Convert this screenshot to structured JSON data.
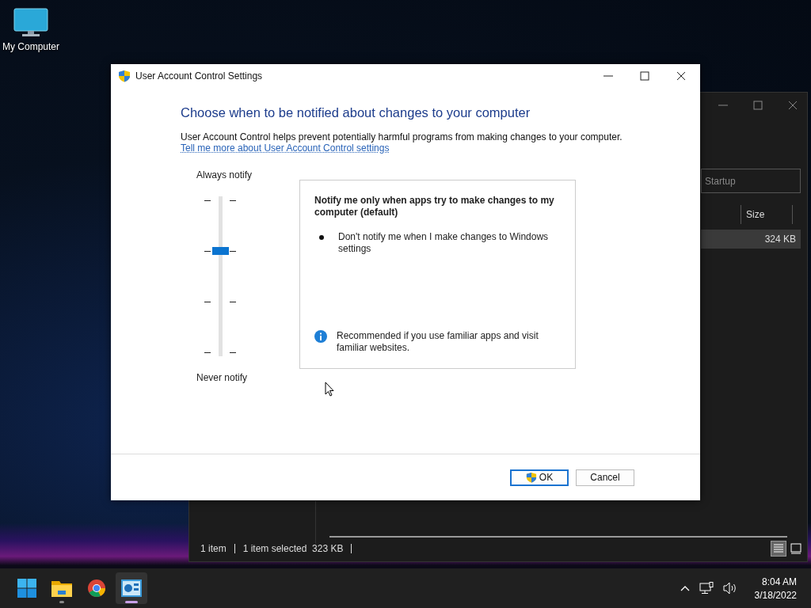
{
  "desktop": {
    "icons": [
      {
        "label": "My Computer"
      }
    ]
  },
  "explorer": {
    "search": {
      "placeholder": "Startup"
    },
    "columns": [
      "Size"
    ],
    "rows": [
      {
        "size": "324 KB",
        "selected": true
      }
    ],
    "status_bar": {
      "items": "1 item",
      "selection": "1 item selected  323 KB"
    },
    "views": [
      {
        "kind": "details",
        "selected": true
      },
      {
        "kind": "tiles",
        "selected": false
      }
    ]
  },
  "dialog": {
    "title": "User Account Control Settings",
    "heading": "Choose when to be notified about changes to your computer",
    "description": "User Account Control helps prevent potentially harmful programs from making changes to your computer.",
    "link": "Tell me more about User Account Control settings",
    "slider": {
      "top_label": "Always notify",
      "bottom_label": "Never notify",
      "level": 0.667
    },
    "info": {
      "title": "Notify me only when apps try to make changes to my computer (default)",
      "bullets": [
        "Don't notify me when I make changes to Windows settings"
      ],
      "recommendation": "Recommended if you use familiar apps and visit familiar websites."
    },
    "buttons": [
      {
        "label": "OK",
        "kind": "shield",
        "default": true
      },
      {
        "label": "Cancel",
        "kind": "plain",
        "default": false
      }
    ]
  },
  "taskbar": {
    "apps": [
      {
        "kind": "start",
        "running": false,
        "active": false
      },
      {
        "kind": "folder",
        "running": true,
        "active": false
      },
      {
        "kind": "browser",
        "running": false,
        "active": false
      },
      {
        "kind": "control-panel",
        "running": true,
        "active": true
      }
    ],
    "clock": {
      "time": "8:04 AM",
      "date": "3/18/2022"
    }
  }
}
